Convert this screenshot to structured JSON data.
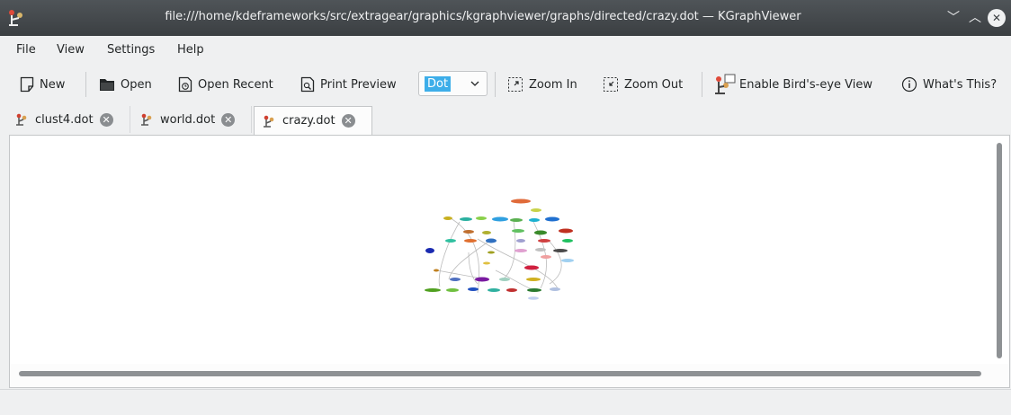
{
  "window": {
    "title": "file:///home/kdeframeworks/src/extragear/graphics/kgraphviewer/graphs/directed/crazy.dot — KGraphViewer",
    "controls": {
      "minimize": "﹀",
      "maximize": "︿",
      "close": "✕"
    }
  },
  "menubar": {
    "items": [
      "File",
      "View",
      "Settings",
      "Help"
    ]
  },
  "toolbar": {
    "new": "New",
    "open": "Open",
    "open_recent": "Open Recent",
    "print_preview": "Print Preview",
    "layout_value": "Dot",
    "zoom_in": "Zoom In",
    "zoom_out": "Zoom Out",
    "birds_eye": "Enable Bird's-eye View",
    "whats_this": "What's This?"
  },
  "tabs": [
    {
      "label": "clust4.dot",
      "active": false
    },
    {
      "label": "world.dot",
      "active": false
    },
    {
      "label": "crazy.dot",
      "active": true
    }
  ],
  "colors": {
    "titlebar": "#3b3f42",
    "accent": "#3daee9",
    "window_bg": "#eff0f1"
  }
}
